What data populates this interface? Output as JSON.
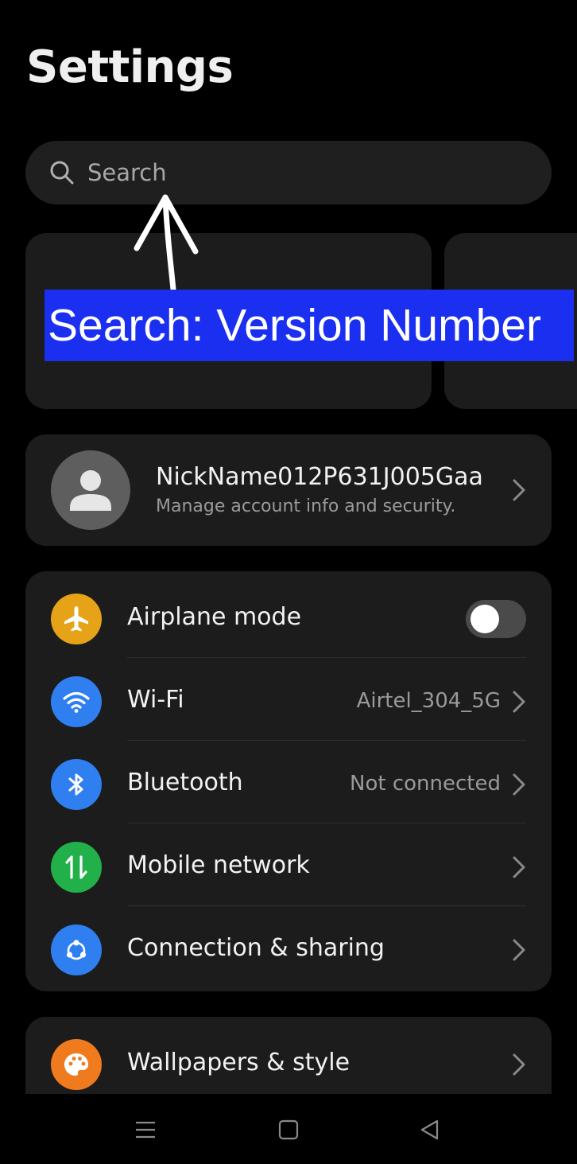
{
  "page": {
    "title": "Settings"
  },
  "search": {
    "placeholder": "Search"
  },
  "annotation": {
    "text": "Search: Version Number"
  },
  "account": {
    "name": "NickName012P631J005Gaa",
    "subtitle": "Manage account info and security."
  },
  "connectivity": {
    "items": [
      {
        "label": "Airplane mode",
        "icon": "airplane-icon",
        "color": "#e6a317",
        "toggle": false
      },
      {
        "label": "Wi-Fi",
        "value": "Airtel_304_5G",
        "icon": "wifi-icon",
        "color": "#2f7ff0"
      },
      {
        "label": "Bluetooth",
        "value": "Not connected",
        "icon": "bluetooth-icon",
        "color": "#2f7ff0"
      },
      {
        "label": "Mobile network",
        "icon": "mobile-network-icon",
        "color": "#22b04a"
      },
      {
        "label": "Connection & sharing",
        "icon": "connection-sharing-icon",
        "color": "#2f7ff0"
      }
    ]
  },
  "personalization": {
    "items": [
      {
        "label": "Wallpapers & style",
        "icon": "palette-icon",
        "color": "#f07a1e"
      }
    ]
  },
  "navbar": {
    "icons": [
      "menu-icon",
      "home-icon",
      "back-icon"
    ]
  }
}
